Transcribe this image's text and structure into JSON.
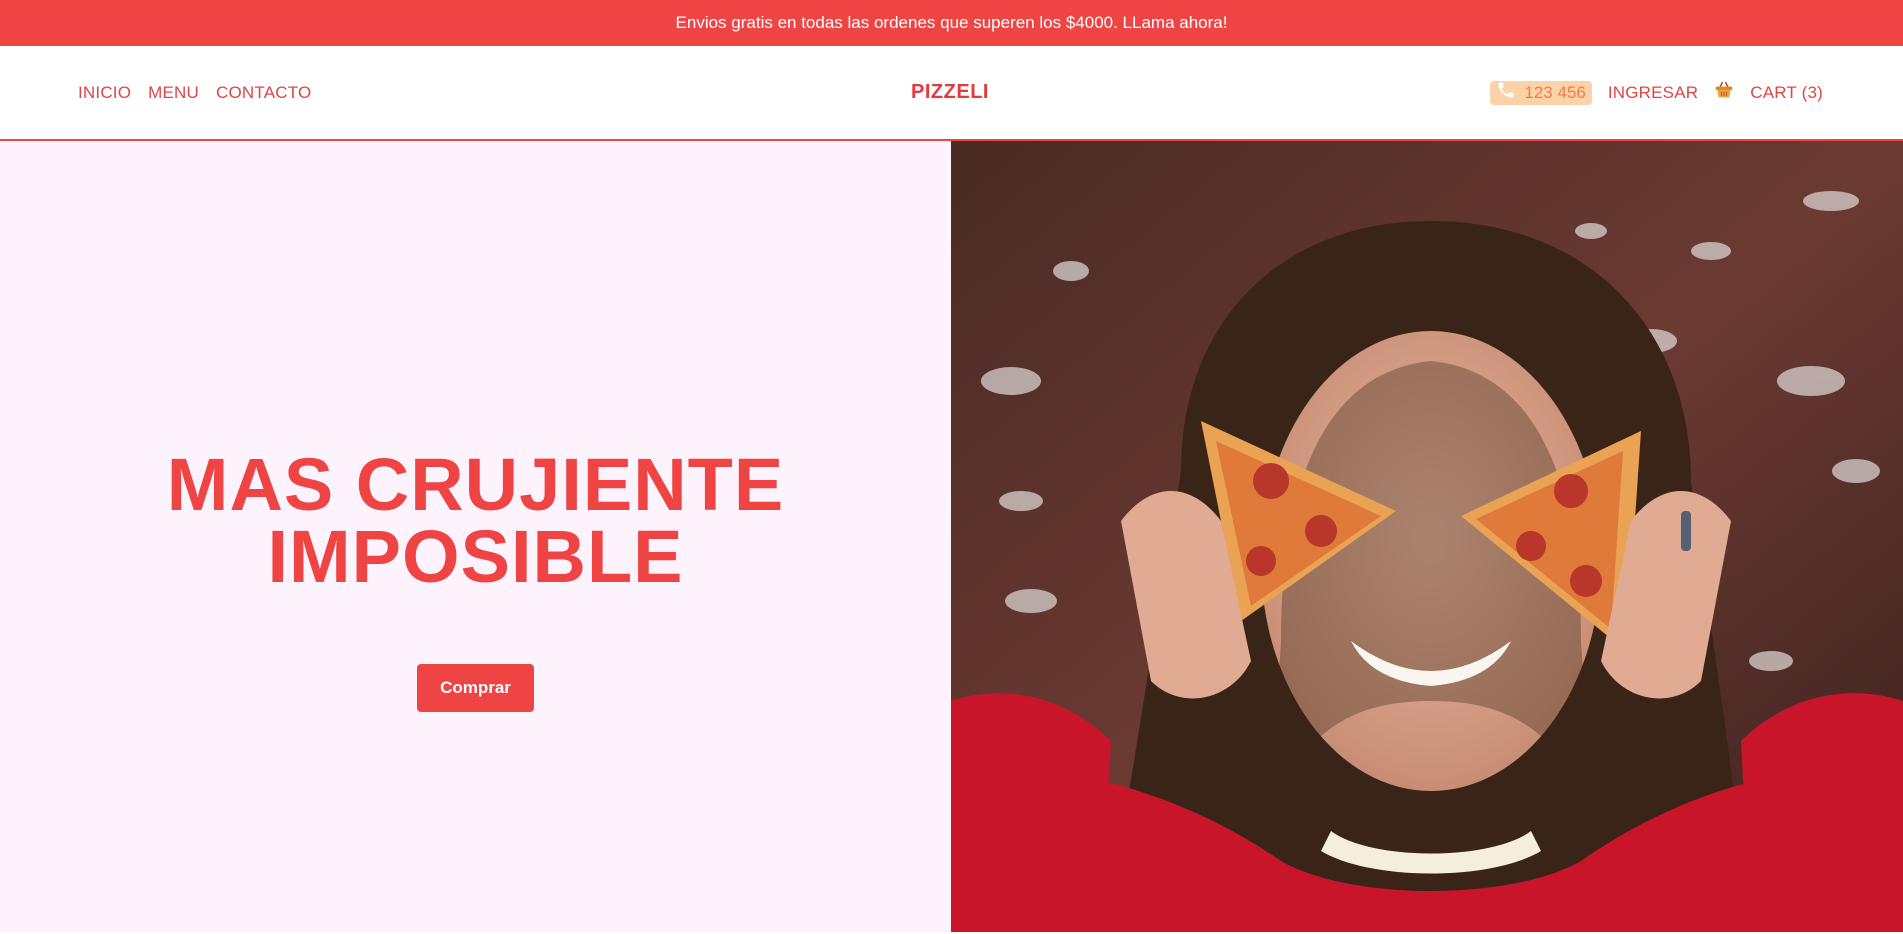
{
  "promo": {
    "text": "Envios gratis en todas las ordenes que superen los $4000. LLama ahora!"
  },
  "nav": {
    "links": [
      "INICIO",
      "MENU",
      "CONTACTO"
    ],
    "brand": "PIZZELI",
    "phone": "123 456",
    "login": "INGRESAR",
    "cart": "CART (3)"
  },
  "hero": {
    "headline_line1": "MAS CRUJIENTE",
    "headline_line2": "IMPOSIBLE",
    "cta": "Comprar"
  },
  "colors": {
    "accent": "#ef4444",
    "hero_bg": "#fdf3fd",
    "phone_bg": "#fcd3a9",
    "phone_text": "#f47b4a"
  },
  "icons": {
    "phone": "phone-icon",
    "cart": "basket-icon"
  }
}
